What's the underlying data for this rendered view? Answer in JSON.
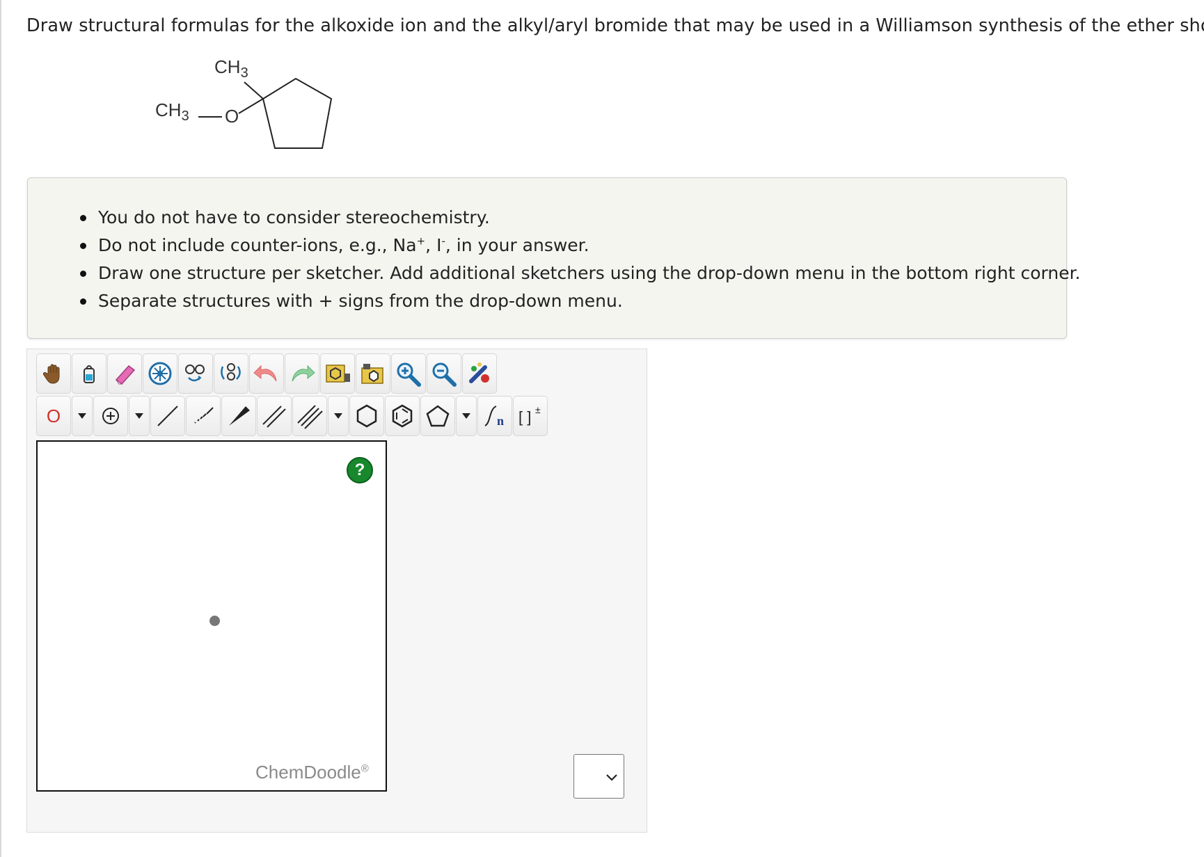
{
  "question": {
    "text": "Draw structural formulas for the alkoxide ion and the alkyl/aryl bromide that may be used in a Williamson synthesis of the ether shown."
  },
  "molecule": {
    "label_ch3_top": "CH",
    "label_ch3_top_sub": "3",
    "label_ch3_left": "CH",
    "label_ch3_left_sub": "3",
    "label_o": "O"
  },
  "instructions": {
    "items": [
      "You do not have to consider stereochemistry.",
      "Do not include counter-ions, e.g., Na",
      "Draw one structure per sketcher. Add additional sketchers using the drop-down menu in the bottom right corner.",
      "Separate structures with + signs from the drop-down menu."
    ],
    "item2_sup1": "+",
    "item2_mid": ", I",
    "item2_sup2": "-",
    "item2_end": ", in your answer."
  },
  "sketcher": {
    "toolbar_row1": [
      "hand-icon",
      "lasso-icon",
      "eraser-icon",
      "clear-icon",
      "copy-icon",
      "paste-icon",
      "undo-icon",
      "redo-icon",
      "template-icon",
      "open-file-icon",
      "zoom-in-icon",
      "zoom-out-icon",
      "clean-icon"
    ],
    "toolbar_row2": [
      "element-O",
      "charge-plus",
      "single-bond",
      "hash-bond",
      "wedge-bond",
      "double-bond",
      "triple-bond",
      "cyclohexane",
      "benzene",
      "cyclopentane",
      "repeat-unit",
      "bracket"
    ],
    "element_label": "O",
    "help_label": "?",
    "watermark": "ChemDoodle",
    "watermark_mark": "®",
    "bracket_label": "[ ]",
    "bracket_sup": "±",
    "repeat_label": "n"
  },
  "colors": {
    "element_red": "#d0312d",
    "help_green": "#17882c"
  }
}
